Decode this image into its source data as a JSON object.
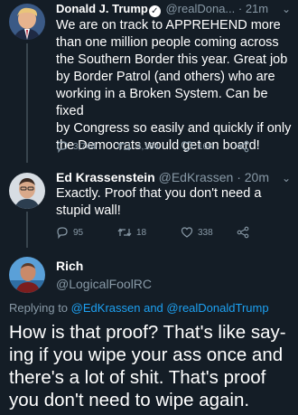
{
  "tweets": [
    {
      "name": "Donald J. Trump",
      "handle": "@realDona...",
      "time": "· 21m",
      "lines": [
        "We are on track to APPREHEND more",
        "than one million people coming across",
        "the Southern Border this year. Great job",
        "by Border Patrol (and others) who are",
        "working in a Broken System. Can be fixed",
        "by Congress so easily and quickly if only",
        "the Democrats would get on board!"
      ],
      "replies": "3,744",
      "retweets": "4,164",
      "likes": "16K"
    },
    {
      "name": "Ed Krassenstein",
      "handle": "@EdKrassen",
      "time": "· 20m",
      "lines": [
        "Exactly.  Proof that you don't need a",
        "stupid wall!"
      ],
      "replies": "95",
      "retweets": "18",
      "likes": "338"
    }
  ],
  "reply": {
    "name": "Rich",
    "handle": "@LogicalFoolRC",
    "replying_prefix": "Replying to",
    "replying_user1": "@EdKrassen",
    "replying_and": "and",
    "replying_user2": "@realDonaldTrump",
    "lines": [
      "How is that proof? That's like say-",
      "ing if you wipe your ass once and",
      "there's a lot of shit. That's proof",
      "you don't need to wipe again."
    ]
  },
  "colors": {
    "background": "#141d26",
    "text": "#ffffff",
    "muted": "#8899a6",
    "link": "#1da1f2"
  },
  "icons": [
    "reply-icon",
    "retweet-icon",
    "like-icon",
    "share-icon",
    "verified-icon",
    "caret-down-icon"
  ]
}
